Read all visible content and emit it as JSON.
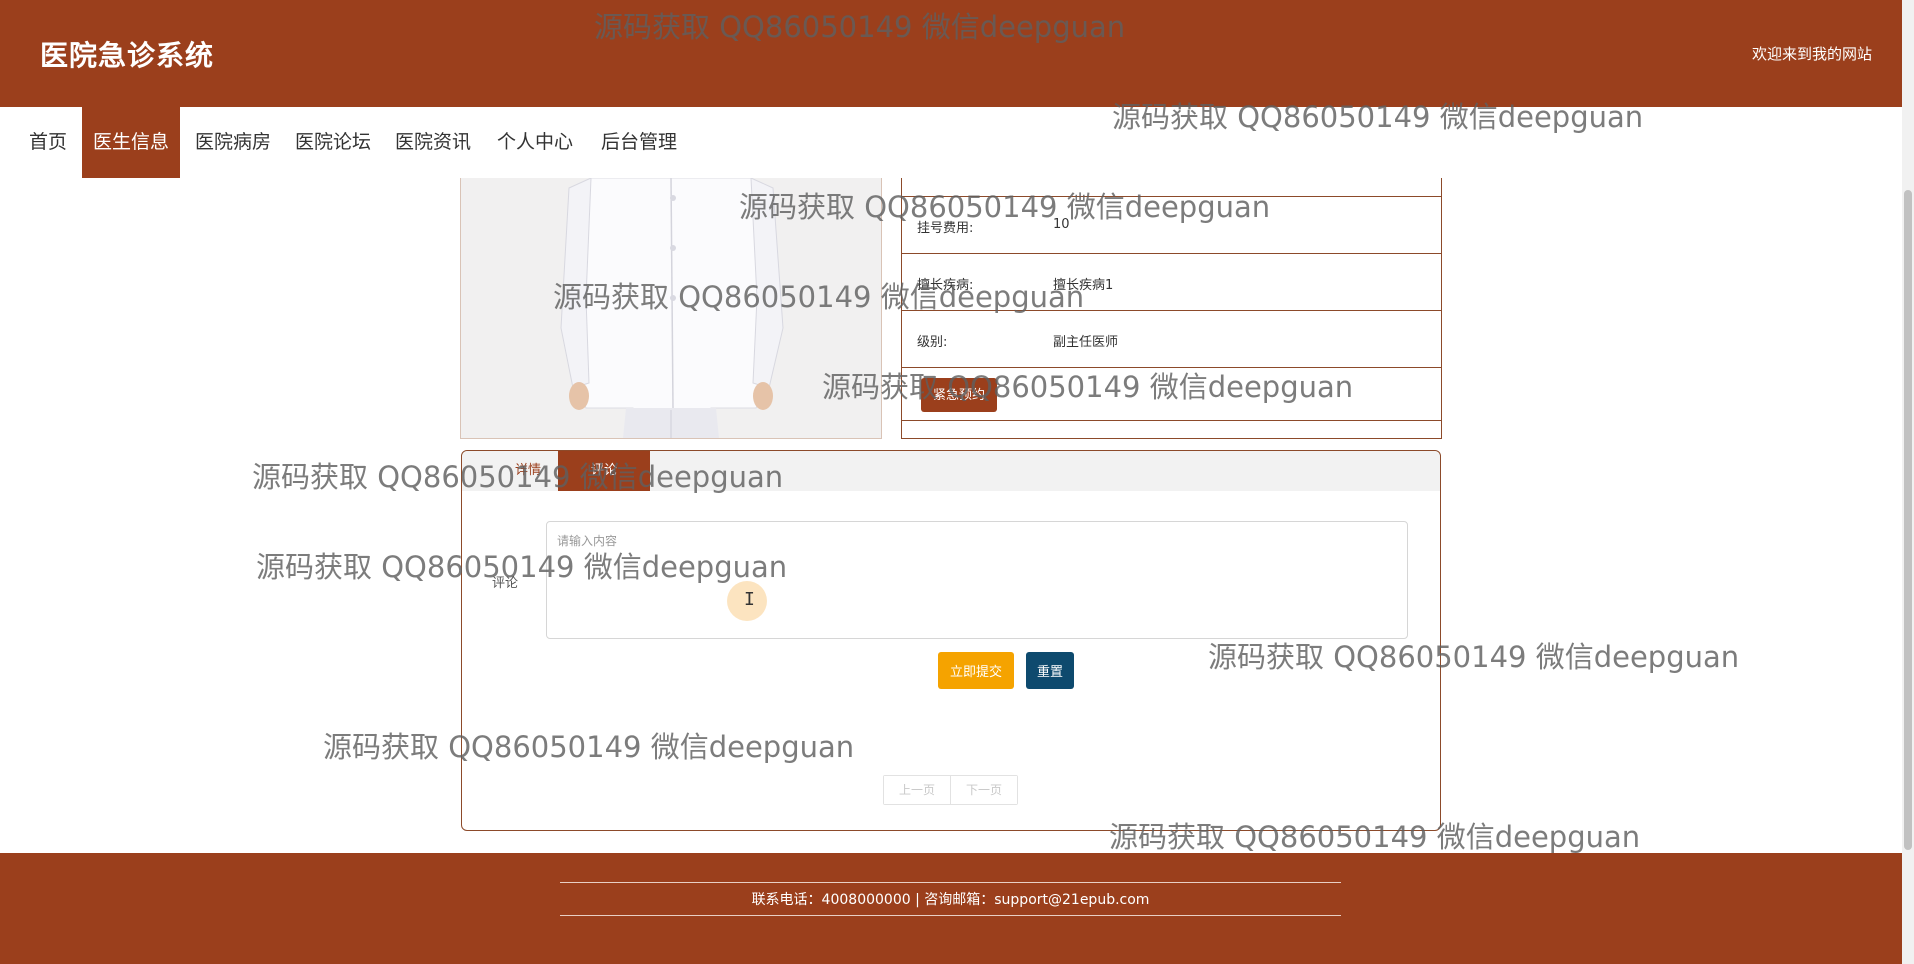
{
  "header": {
    "site_title": "医院急诊系统",
    "welcome_text": "欢迎来到我的网站"
  },
  "nav": {
    "items": [
      {
        "label": "首页",
        "active": false
      },
      {
        "label": "医生信息",
        "active": true
      },
      {
        "label": "医院病房",
        "active": false
      },
      {
        "label": "医院论坛",
        "active": false
      },
      {
        "label": "医院资讯",
        "active": false
      },
      {
        "label": "个人中心",
        "active": false
      },
      {
        "label": "后台管理",
        "active": false
      }
    ]
  },
  "doctor": {
    "fee_label": "挂号费用:",
    "fee_value": "10",
    "specialty_label": "擅长疾病:",
    "specialty_value": "擅长疾病1",
    "level_label": "级别:",
    "level_value": "副主任医师",
    "emergency_button": "紧急预约"
  },
  "comment_panel": {
    "tab_detail": "详情",
    "tab_comment": "评论",
    "field_label": "评论",
    "textarea_placeholder": "请输入内容",
    "submit_button": "立即提交",
    "reset_button": "重置",
    "prev_page": "上一页",
    "next_page": "下一页"
  },
  "footer": {
    "contact_text": "联系电话：4008000000 | 咨询邮箱：support@21epub.com"
  },
  "watermark_text": "源码获取 QQ86050149 微信deepguan",
  "colors": {
    "brand": "#9b3f1c",
    "submit": "#f5a300",
    "reset": "#0e4a6e"
  }
}
